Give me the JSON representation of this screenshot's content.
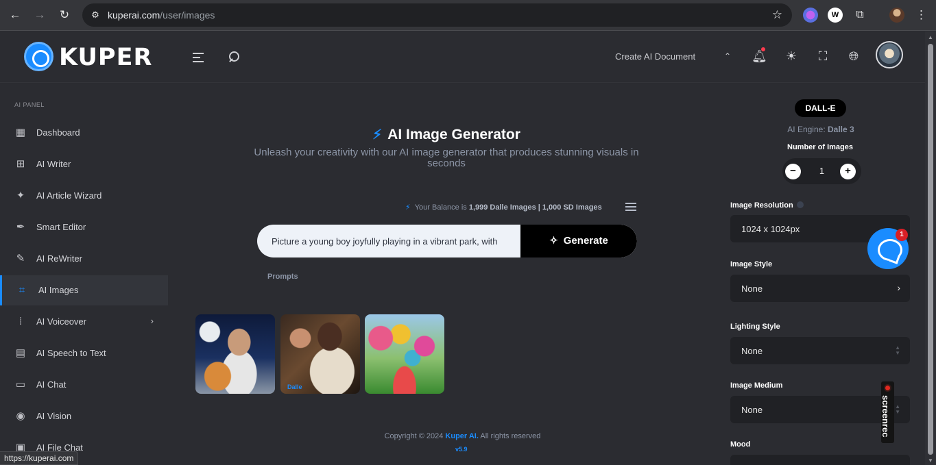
{
  "browser": {
    "url_domain": "kuperai.com",
    "url_path": "/user/images",
    "status_url": "https://kuperai.com"
  },
  "header": {
    "brand": "KUPER",
    "create_doc": "Create AI Document"
  },
  "sidebar": {
    "section_label": "AI PANEL",
    "items": [
      {
        "label": "Dashboard",
        "icon": "dashboard-icon"
      },
      {
        "label": "AI Writer",
        "icon": "ai-writer-icon"
      },
      {
        "label": "AI Article Wizard",
        "icon": "sparkle-icon"
      },
      {
        "label": "Smart Editor",
        "icon": "feather-icon"
      },
      {
        "label": "AI ReWriter",
        "icon": "pen-icon"
      },
      {
        "label": "AI Images",
        "icon": "image-scan-icon"
      },
      {
        "label": "AI Voiceover",
        "icon": "waveform-icon"
      },
      {
        "label": "AI Speech to Text",
        "icon": "speech-text-icon"
      },
      {
        "label": "AI Chat",
        "icon": "chat-icon"
      },
      {
        "label": "AI Vision",
        "icon": "vision-icon"
      },
      {
        "label": "AI File Chat",
        "icon": "file-chat-icon"
      }
    ],
    "active_item": "AI Images"
  },
  "main": {
    "title": "AI Image Generator",
    "subtitle": "Unleash your creativity with our AI image generator that produces stunning visuals in seconds",
    "balance_prefix": "Your Balance is",
    "balance_value": "1,999 Dalle Images | 1,000 SD Images",
    "prompt_value": "Picture a young boy joyfully playing in a vibrant park, with",
    "generate_label": "Generate",
    "prompts_link": "Prompts",
    "thumb_label": "Dalle",
    "copyright_prefix": "Copyright © 2024",
    "copyright_brand": "Kuper AI.",
    "copyright_suffix": "All rights reserved",
    "version": "v5.9"
  },
  "settings": {
    "engine_pill": "DALL-E",
    "engine_label": "AI Engine:",
    "engine_value": "Dalle 3",
    "num_images_label": "Number of Images",
    "num_images": "1",
    "resolution_label": "Image Resolution",
    "resolution_value": "1024 x 1024px",
    "style_label": "Image Style",
    "style_value": "None",
    "lighting_label": "Lighting Style",
    "lighting_value": "None",
    "medium_label": "Image Medium",
    "medium_value": "None",
    "mood_label": "Mood"
  },
  "chat_widget": {
    "badge": "1"
  },
  "screenrec": {
    "label": "screenrec"
  },
  "colors": {
    "accent": "#1a8cff",
    "background": "#2b2c31",
    "field": "#202125"
  }
}
